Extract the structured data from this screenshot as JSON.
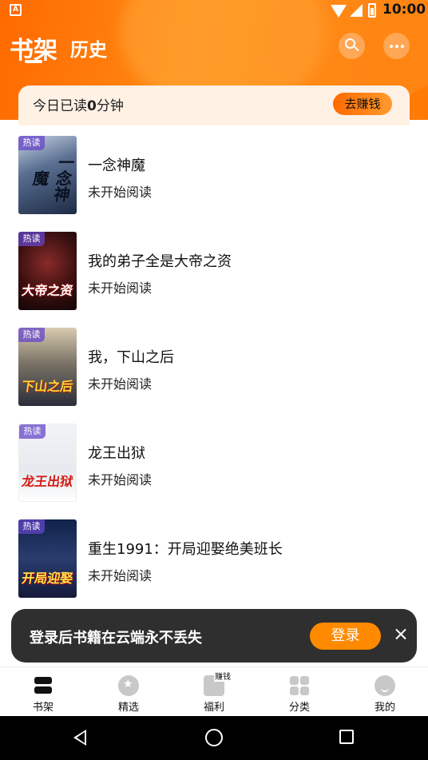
{
  "status_bar": {
    "app_icon_letter": "A",
    "time": "10:00"
  },
  "header": {
    "tabs": [
      {
        "label": "书架",
        "active": true
      },
      {
        "label": "历史",
        "active": false
      }
    ],
    "icons": [
      "search-icon",
      "more-icon"
    ],
    "accent_color": "#ff7a05"
  },
  "read_card": {
    "prefix": "今日已读",
    "minutes": "0",
    "suffix": "分钟",
    "earn_label": "去赚钱"
  },
  "books": [
    {
      "tag": "热读",
      "cover_text": "一念神魔",
      "title": "一念神魔",
      "status": "未开始阅读"
    },
    {
      "tag": "热读",
      "cover_text": "大帝之资",
      "title": "我的弟子全是大帝之资",
      "status": "未开始阅读"
    },
    {
      "tag": "热读",
      "cover_text": "下山之后",
      "title": "我，下山之后",
      "status": "未开始阅读"
    },
    {
      "tag": "热读",
      "cover_text": "龙王出狱",
      "title": "龙王出狱",
      "status": "未开始阅读"
    },
    {
      "tag": "热读",
      "cover_text": "开局迎娶",
      "title": "重生1991：开局迎娶绝美班长",
      "status": "未开始阅读"
    }
  ],
  "login_toast": {
    "message": "登录后书籍在云端永不丢失",
    "button_label": "登录"
  },
  "bottom_nav": {
    "items": [
      {
        "label": "书架",
        "icon": "bookshelf-icon",
        "active": true
      },
      {
        "label": "精选",
        "icon": "featured-star-icon",
        "active": false
      },
      {
        "label": "福利",
        "icon": "welfare-gift-icon",
        "active": false,
        "badge": "赚钱"
      },
      {
        "label": "分类",
        "icon": "category-grid-icon",
        "active": false
      },
      {
        "label": "我的",
        "icon": "profile-icon",
        "active": false
      }
    ]
  }
}
